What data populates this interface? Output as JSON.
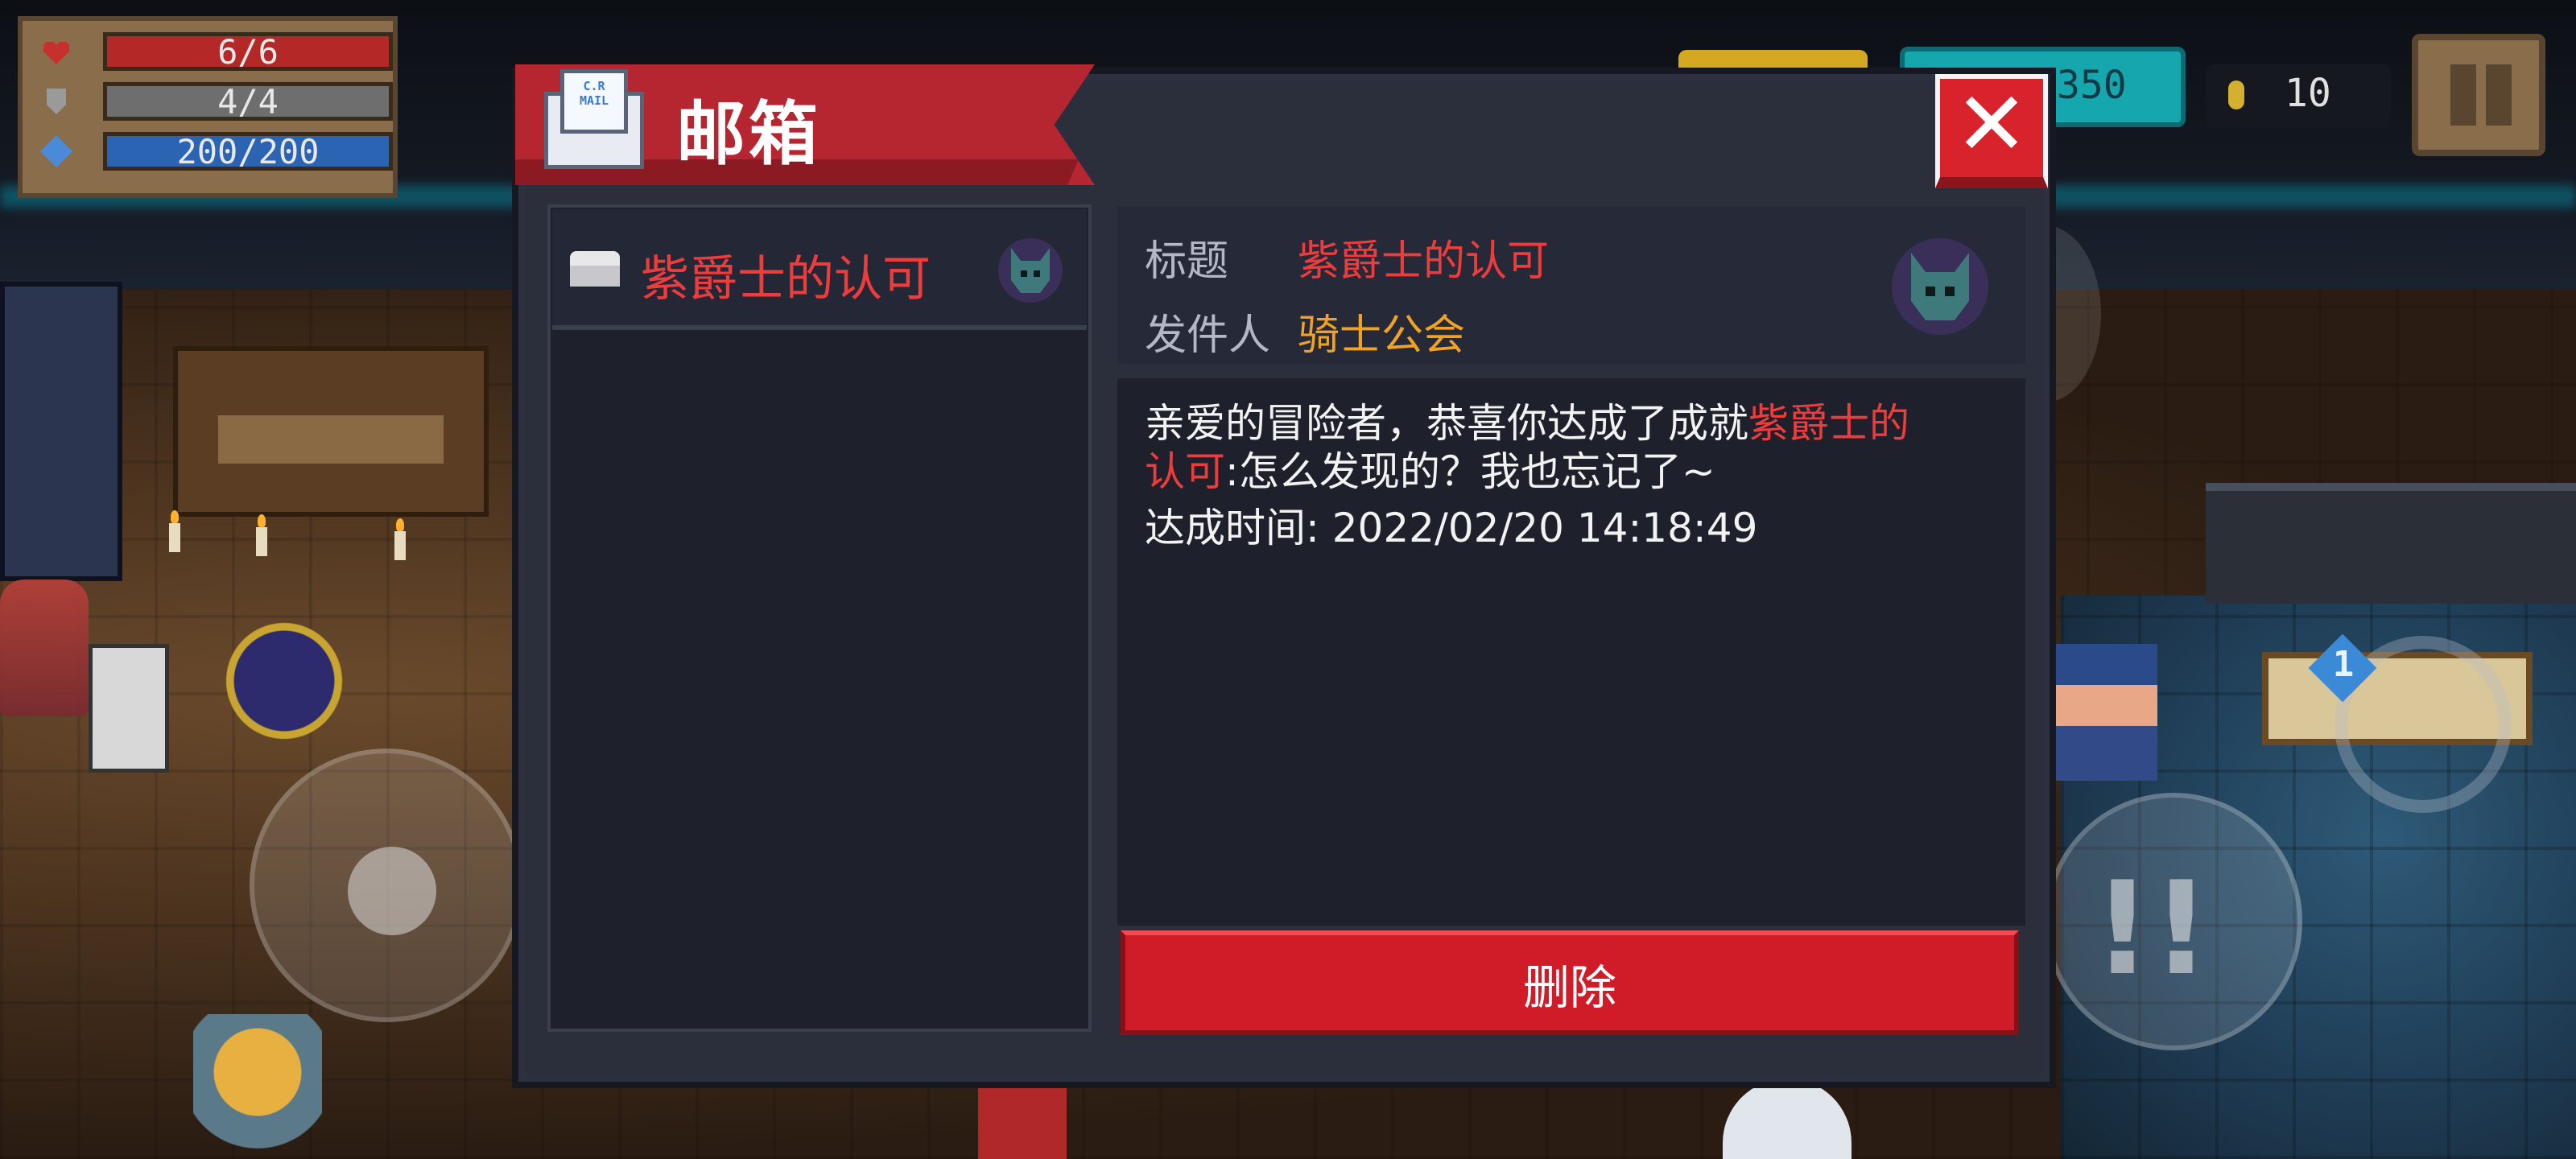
{
  "hud": {
    "hp": "6/6",
    "armor": "4/4",
    "energy": "200/200",
    "gems": "350",
    "coins": "10"
  },
  "mailbox": {
    "title": "邮箱",
    "envelope_text": "C.R\nMAIL",
    "list": [
      {
        "title": "紫爵士的认可"
      }
    ],
    "detail": {
      "subject_label": "标题",
      "subject": "紫爵士的认可",
      "sender_label": "发件人",
      "sender": "骑士公会",
      "body_prefix": "亲爱的冒险者，恭喜你达成了成就",
      "body_highlight_1": "紫爵士的",
      "body_highlight_2": "认可",
      "body_suffix": ":怎么发现的？我也忘记了~",
      "achieved_time": "达成时间: 2022/02/20 14:18:49"
    },
    "delete_label": "删除"
  },
  "controls": {
    "weapon_slot": "1"
  },
  "colors": {
    "dialog_bg": "#2b2f3c",
    "title_ribbon": "#b62630",
    "highlight_red": "#ee3b3b",
    "sender_orange": "#f0a224",
    "delete_button": "#d01c28"
  }
}
